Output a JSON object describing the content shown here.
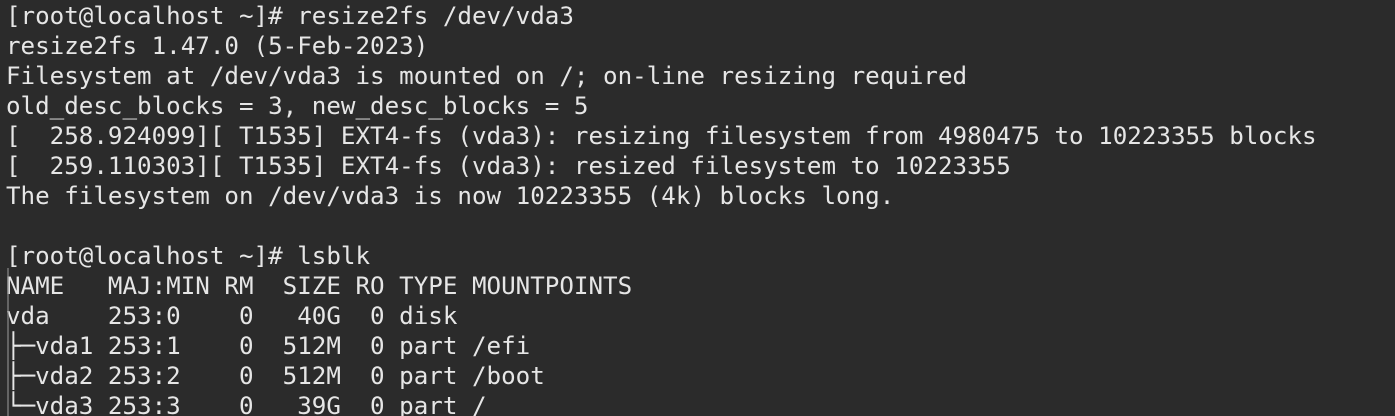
{
  "terminal": {
    "lines": [
      "[root@localhost ~]# resize2fs /dev/vda3",
      "resize2fs 1.47.0 (5-Feb-2023)",
      "Filesystem at /dev/vda3 is mounted on /; on-line resizing required",
      "old_desc_blocks = 3, new_desc_blocks = 5",
      "[  258.924099][ T1535] EXT4-fs (vda3): resizing filesystem from 4980475 to 10223355 blocks",
      "[  259.110303][ T1535] EXT4-fs (vda3): resized filesystem to 10223355",
      "The filesystem on /dev/vda3 is now 10223355 (4k) blocks long.",
      "",
      "[root@localhost ~]# lsblk",
      "NAME   MAJ:MIN RM  SIZE RO TYPE MOUNTPOINTS",
      "vda    253:0    0   40G  0 disk",
      "├─vda1 253:1    0  512M  0 part /efi",
      "├─vda2 253:2    0  512M  0 part /boot",
      "└─vda3 253:3    0   39G  0 part /"
    ]
  },
  "colors": {
    "background": "#2b2b2b",
    "text": "#e6e6e6"
  }
}
